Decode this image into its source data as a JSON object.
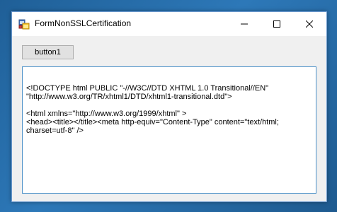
{
  "window": {
    "title": "FormNonSSLCertification",
    "icon": "winforms-app-icon",
    "controls": {
      "minimize": "minimize-icon",
      "maximize": "maximize-icon",
      "close": "close-icon"
    }
  },
  "form": {
    "button_label": "button1",
    "textbox_lines": [
      "<!DOCTYPE html PUBLIC \"-//W3C//DTD XHTML 1.0 Transitional//EN\"",
      "\"http://www.w3.org/TR/xhtml1/DTD/xhtml1-transitional.dtd\">",
      "",
      "<html xmlns=\"http://www.w3.org/1999/xhtml\" >",
      "<head><title></title><meta http-equiv=\"Content-Type\" content=\"text/html;",
      "charset=utf-8\" />"
    ]
  },
  "colors": {
    "desktop": "#2b6a9e",
    "window_border": "#6d9bd0",
    "textbox_border": "#4a90c8",
    "button_face": "#e1e1e1"
  }
}
